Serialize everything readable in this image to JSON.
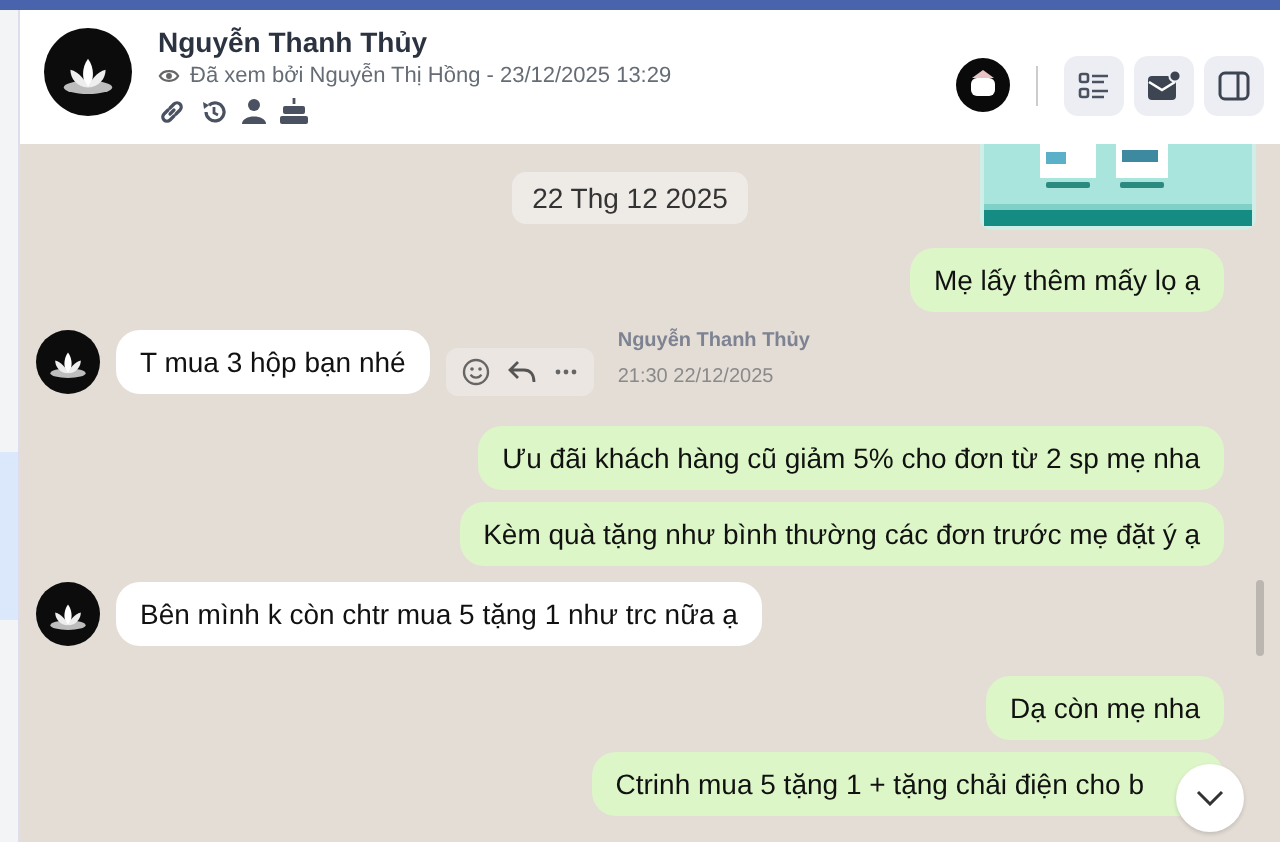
{
  "contact": {
    "name": "Nguyễn Thanh Thủy",
    "seen": "Đã xem bởi Nguyễn Thị Hồng - 23/12/2025 13:29"
  },
  "messages": [
    {
      "kind": "picture"
    },
    {
      "kind": "date",
      "text": "22 Thg 12 2025"
    },
    {
      "kind": "outgoing",
      "text": "Mẹ lấy thêm mấy lọ ạ"
    },
    {
      "kind": "incoming",
      "text": "T mua 3 hộp bạn nhé",
      "sender": "Nguyễn Thanh Thủy",
      "time": "21:30 22/12/2025"
    },
    {
      "kind": "outgoing",
      "text": "Ưu đãi khách hàng cũ giảm 5% cho đơn từ 2 sp mẹ nha"
    },
    {
      "kind": "outgoing",
      "text": "Kèm quà tặng như bình thường các đơn trước mẹ đặt ý ạ"
    },
    {
      "kind": "incoming",
      "text": "Bên mình k còn chtr mua 5 tặng 1 như trc nữa ạ"
    },
    {
      "kind": "outgoing",
      "text": "Dạ còn mẹ nha"
    },
    {
      "kind": "outgoing",
      "text": "Ctrinh mua 5 tặng 1 + tặng chải điện cho b"
    }
  ]
}
